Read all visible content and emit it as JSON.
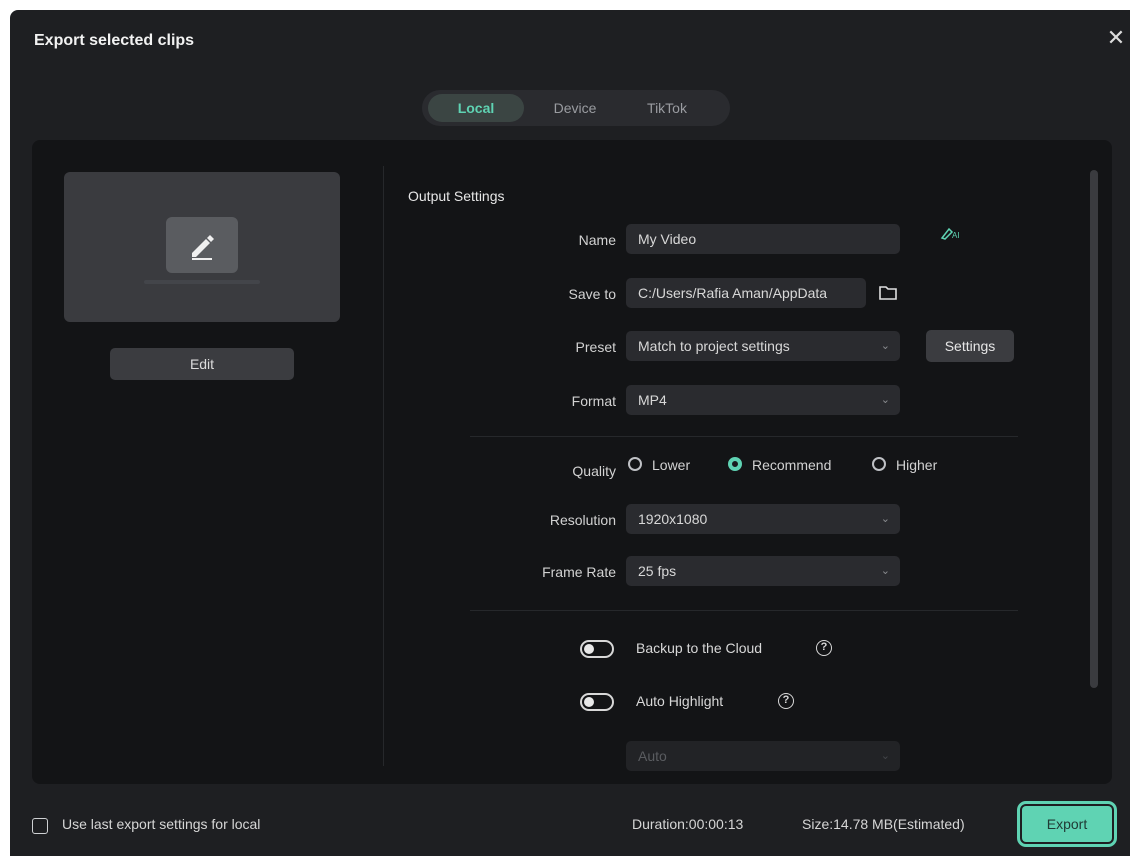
{
  "dialog": {
    "title": "Export selected clips",
    "close_icon": "close-icon"
  },
  "tabs": [
    {
      "label": "Local",
      "active": true
    },
    {
      "label": "Device",
      "active": false
    },
    {
      "label": "TikTok",
      "active": false
    }
  ],
  "left_panel": {
    "edit_label": "Edit"
  },
  "output_settings": {
    "section_title": "Output Settings",
    "name": {
      "label": "Name",
      "value": "My Video",
      "icon": "ai-rename-icon"
    },
    "save_to": {
      "label": "Save to",
      "value": "C:/Users/Rafia Aman/AppData",
      "icon": "folder-icon"
    },
    "preset": {
      "label": "Preset",
      "value": "Match to project settings",
      "settings_label": "Settings"
    },
    "format": {
      "label": "Format",
      "value": "MP4"
    },
    "quality": {
      "label": "Quality",
      "options": [
        {
          "label": "Lower",
          "selected": false
        },
        {
          "label": "Recommend",
          "selected": true
        },
        {
          "label": "Higher",
          "selected": false
        }
      ]
    },
    "resolution": {
      "label": "Resolution",
      "value": "1920x1080"
    },
    "frame_rate": {
      "label": "Frame Rate",
      "value": "25 fps"
    },
    "backup": {
      "label": "Backup to the Cloud",
      "enabled": false
    },
    "auto_highlight": {
      "label": "Auto Highlight",
      "enabled": false
    },
    "auto_select": {
      "value": "Auto"
    }
  },
  "footer": {
    "checkbox_label": "Use last export settings for local",
    "duration": "Duration:00:00:13",
    "size": "Size:14.78 MB(Estimated)",
    "export_label": "Export"
  },
  "colors": {
    "accent": "#5fd3b3",
    "background": "#1e1f22",
    "panel": "#131416"
  }
}
